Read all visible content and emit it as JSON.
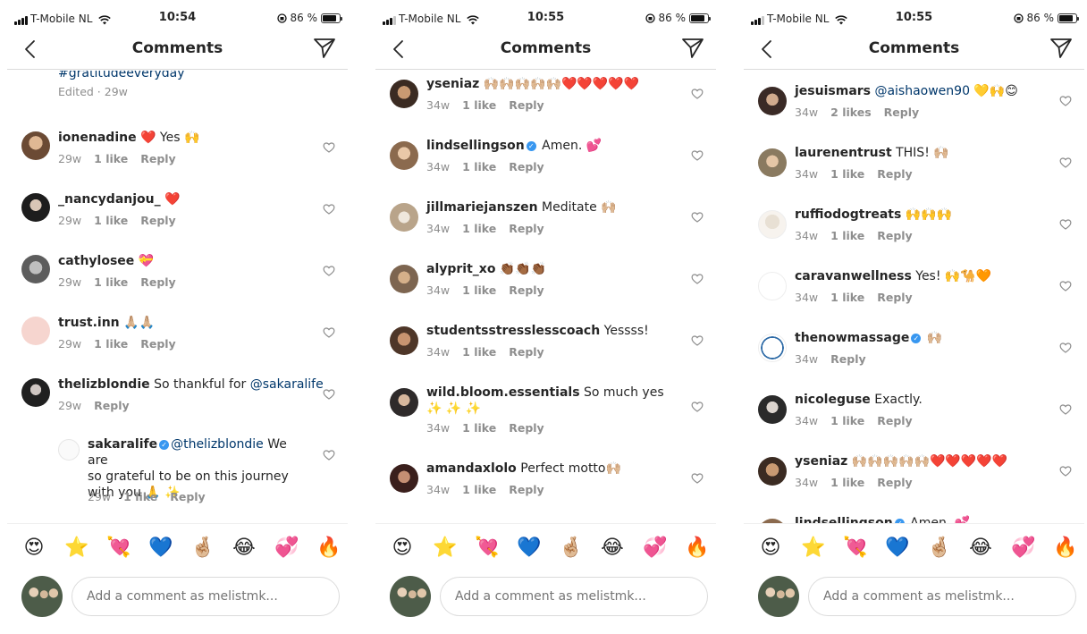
{
  "screens": [
    {
      "status": {
        "carrier": "T-Mobile NL",
        "time": "10:54",
        "battery": "86 %"
      },
      "nav": {
        "title": "Comments"
      },
      "caption_tail": {
        "hashtag": "#gratitudeeveryday",
        "meta": "Edited · 29w"
      },
      "comments": [
        {
          "username": "ionenadine",
          "text": "❤️ Yes 🙌",
          "age": "29w",
          "likes": "1 like",
          "reply": "Reply"
        },
        {
          "username": "_nancydanjou_",
          "text": "❤️",
          "age": "29w",
          "likes": "1 like",
          "reply": "Reply"
        },
        {
          "username": "cathylosee",
          "text": "💝",
          "age": "29w",
          "likes": "1 like",
          "reply": "Reply"
        },
        {
          "username": "trust.inn",
          "text": "🙏🏼🙏🏼",
          "age": "29w",
          "likes": "1 like",
          "reply": "Reply"
        },
        {
          "username": "thelizblondie",
          "text": "So thankful for ",
          "mention": "@sakaralife",
          "age": "29w",
          "reply": "Reply"
        }
      ],
      "reply": {
        "username": "sakaralife",
        "mention": "@thelizblondie",
        "text_line1": " We are",
        "text_line2": "so grateful to be on this journey",
        "text_line3": "with you 🙏 ✨",
        "age": "29w",
        "likes": "1 like",
        "reply": "Reply"
      },
      "composer": {
        "placeholder": "Add a comment as melistmk..."
      }
    },
    {
      "status": {
        "carrier": "T-Mobile NL",
        "time": "10:55",
        "battery": "86 %"
      },
      "nav": {
        "title": "Comments"
      },
      "comments": [
        {
          "username": "yseniaz",
          "text": "🙌🏼🙌🏼🙌🏼🙌🏼🙌🏼❤️❤️❤️❤️❤️",
          "age": "34w",
          "likes": "1 like",
          "reply": "Reply"
        },
        {
          "username": "lindsellingson",
          "verified": true,
          "text": "Amen. 💕",
          "age": "34w",
          "likes": "1 like",
          "reply": "Reply"
        },
        {
          "username": "jillmariejanszen",
          "text": "Meditate 🙌🏼",
          "age": "34w",
          "likes": "1 like",
          "reply": "Reply"
        },
        {
          "username": "alyprit_xo",
          "text": "👏🏾👏🏾👏🏾",
          "age": "34w",
          "likes": "1 like",
          "reply": "Reply"
        },
        {
          "username": "studentsstresslesscoach",
          "text": "Yessss!",
          "age": "34w",
          "likes": "1 like",
          "reply": "Reply"
        },
        {
          "username": "wild.bloom.essentials",
          "text": "So much yes",
          "text2": "✨ ✨ ✨",
          "age": "34w",
          "likes": "1 like",
          "reply": "Reply"
        },
        {
          "username": "amandaxlolo",
          "text": "Perfect motto🙌🏼",
          "age": "34w",
          "likes": "1 like",
          "reply": "Reply"
        }
      ],
      "composer": {
        "placeholder": "Add a comment as melistmk..."
      }
    },
    {
      "status": {
        "carrier": "T-Mobile NL",
        "time": "10:55",
        "battery": "86 %"
      },
      "nav": {
        "title": "Comments"
      },
      "comments": [
        {
          "username": "jesuismars",
          "mention": "@aishaowen90",
          "text": " 💛🙌😊",
          "age": "34w",
          "likes": "2 likes",
          "reply": "Reply"
        },
        {
          "username": "laurenentrust",
          "text": "THIS! 🙌🏼",
          "age": "34w",
          "likes": "1 like",
          "reply": "Reply"
        },
        {
          "username": "ruffiodogtreats",
          "text": "🙌🙌🙌",
          "age": "34w",
          "likes": "1 like",
          "reply": "Reply"
        },
        {
          "username": "caravanwellness",
          "text": "Yes! 🙌🐪🧡",
          "age": "34w",
          "likes": "1 like",
          "reply": "Reply"
        },
        {
          "username": "thenowmassage",
          "verified": true,
          "text": "🙌🏼",
          "age": "34w",
          "reply": "Reply"
        },
        {
          "username": "nicoleguse",
          "text": "Exactly.",
          "age": "34w",
          "likes": "1 like",
          "reply": "Reply"
        },
        {
          "username": "yseniaz",
          "text": "🙌🏼🙌🏼🙌🏼🙌🏼🙌🏼❤️❤️❤️❤️❤️",
          "age": "34w",
          "likes": "1 like",
          "reply": "Reply"
        },
        {
          "username": "lindsellingson",
          "verified": true,
          "text": "Amen. 💕"
        }
      ],
      "composer": {
        "placeholder": "Add a comment as melistmk..."
      }
    }
  ],
  "emoji_bar": [
    "😍",
    "⭐",
    "💘",
    "💙",
    "🤞🏼",
    "😂",
    "💞",
    "🔥"
  ],
  "icons": {
    "back": "chevron-left-icon",
    "direct": "paper-plane-icon",
    "like": "heart-outline-icon",
    "verified": "verified-badge-icon"
  },
  "colors": {
    "text": "#262626",
    "muted": "#8e8e8e",
    "link": "#00376b",
    "verified": "#3897f0",
    "divider": "#dbdbdb"
  }
}
